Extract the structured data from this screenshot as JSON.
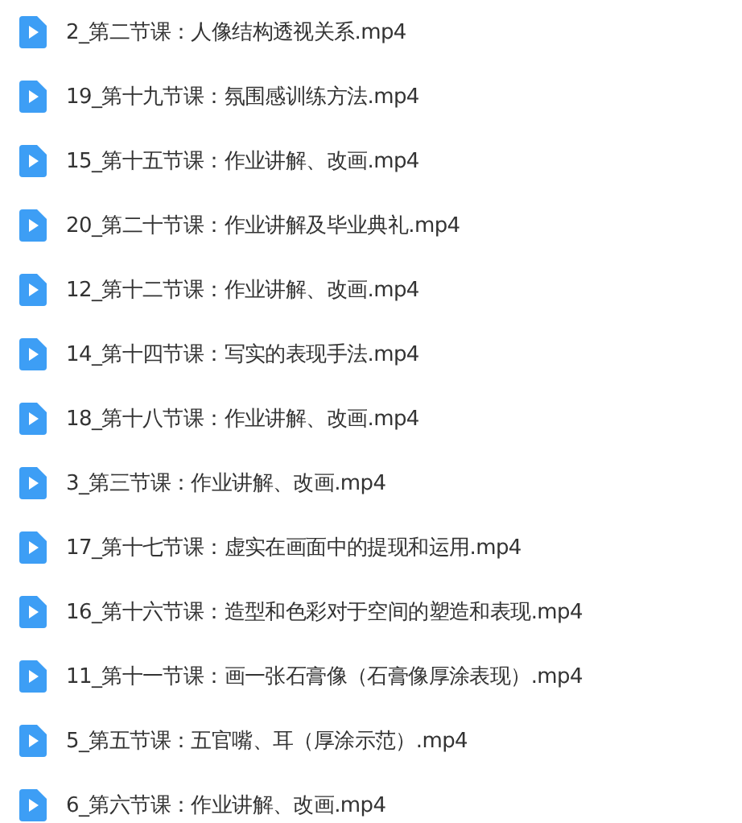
{
  "files": [
    {
      "name": "2_第二节课：人像结构透视关系.mp4"
    },
    {
      "name": "19_第十九节课：氛围感训练方法.mp4"
    },
    {
      "name": "15_第十五节课：作业讲解、改画.mp4"
    },
    {
      "name": "20_第二十节课：作业讲解及毕业典礼.mp4"
    },
    {
      "name": "12_第十二节课：作业讲解、改画.mp4"
    },
    {
      "name": "14_第十四节课：写实的表现手法.mp4"
    },
    {
      "name": "18_第十八节课：作业讲解、改画.mp4"
    },
    {
      "name": "3_第三节课：作业讲解、改画.mp4"
    },
    {
      "name": "17_第十七节课：虚实在画面中的提现和运用.mp4"
    },
    {
      "name": "16_第十六节课：造型和色彩对于空间的塑造和表现.mp4"
    },
    {
      "name": "11_第十一节课：画一张石膏像（石膏像厚涂表现）.mp4"
    },
    {
      "name": "5_第五节课：五官嘴、耳（厚涂示范）.mp4"
    },
    {
      "name": "6_第六节课：作业讲解、改画.mp4"
    }
  ]
}
